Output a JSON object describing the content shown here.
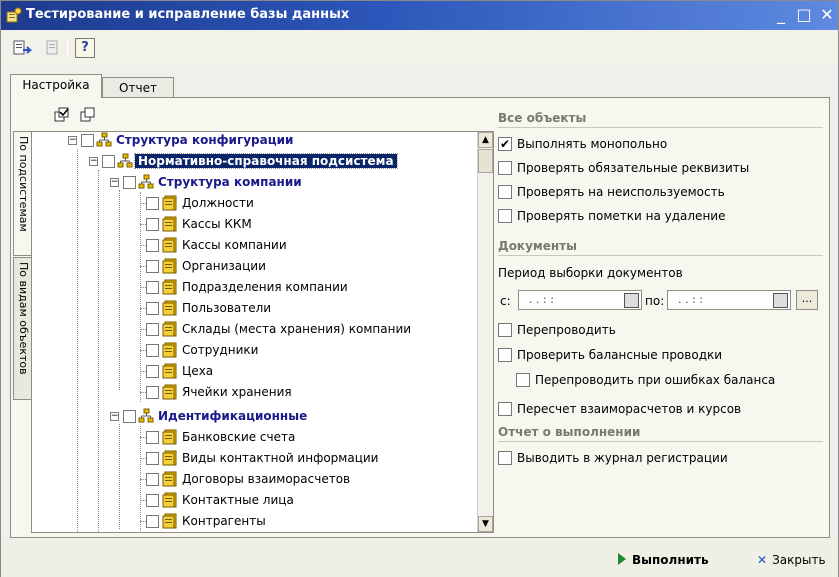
{
  "window": {
    "title": "Тестирование и исправление базы данных",
    "controls": {
      "minimize": "_",
      "maximize": "□",
      "close": "✕"
    }
  },
  "toolbar": {
    "help_label": "?"
  },
  "tabs": [
    "Настройка",
    "Отчет"
  ],
  "vtabs": [
    "По подсистемам",
    "По видам объектов"
  ],
  "tree": {
    "root": "Структура конфигурации",
    "subsystem": "Нормативно-справочная подсистема",
    "group1": "Структура компании",
    "group1_items": [
      "Должности",
      "Кассы ККМ",
      "Кассы компании",
      "Организации",
      "Подразделения компании",
      "Пользователи",
      "Склады (места хранения) компании",
      "Сотрудники",
      "Цеха",
      "Ячейки хранения"
    ],
    "group2": "Идентификационные",
    "group2_items": [
      "Банковские счета",
      "Виды контактной информации",
      "Договоры взаиморасчетов",
      "Контактные лица",
      "Контрагенты"
    ]
  },
  "sections": {
    "all_objects": "Все объекты",
    "documents": "Документы",
    "report": "Отчет о выполнении"
  },
  "options": {
    "monopoly": {
      "label": "Выполнять монопольно",
      "checked": true,
      "mark": "✔"
    },
    "required": {
      "label": "Проверять обязательные реквизиты",
      "checked": false
    },
    "unused": {
      "label": "Проверять на неиспользуемость",
      "checked": false
    },
    "deletion": {
      "label": "Проверять пометки на удаление",
      "checked": false
    },
    "repost": {
      "label": "Перепроводить",
      "checked": false
    },
    "balance": {
      "label": "Проверить балансные проводки",
      "checked": false
    },
    "repost_on_error": {
      "label": "Перепроводить при ошибках баланса",
      "checked": false
    },
    "recalc": {
      "label": "Пересчет взаиморасчетов и курсов",
      "checked": false
    },
    "log": {
      "label": "Выводить в журнал регистрации",
      "checked": false
    }
  },
  "period": {
    "label": "Период выборки документов",
    "from_label": "с:",
    "from_value": " .  .      :  :",
    "to_label": "по:",
    "to_value": " .  .      :  :",
    "more_label": "..."
  },
  "footer": {
    "run_label": "Выполнить",
    "close_label": "Закрыть",
    "close_mark": "✕"
  },
  "colors": {
    "title_bar": "#2c56b9",
    "selection": "#0a246a",
    "bold_node": "#1a1a8c",
    "run_icon": "#1d8c2a"
  }
}
